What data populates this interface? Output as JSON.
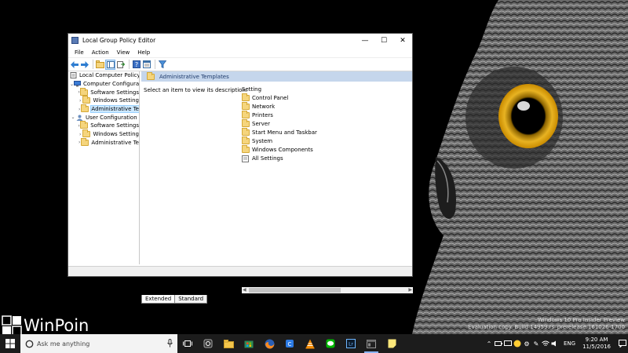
{
  "window": {
    "title": "Local Group Policy Editor",
    "controls": {
      "minimize": "—",
      "maximize": "☐",
      "close": "✕"
    }
  },
  "menu": [
    "File",
    "Action",
    "View",
    "Help"
  ],
  "tree": {
    "root": "Local Computer Policy",
    "computer_config": "Computer Configura",
    "computer_children": [
      "Software Settings",
      "Windows Setting",
      "Administrative Te"
    ],
    "user_config": "User Configuration",
    "user_children": [
      "Software Settings",
      "Windows Setting",
      "Administrative Te"
    ]
  },
  "content": {
    "header": "Administrative Templates",
    "description": "Select an item to view its description.",
    "column_header": "Setting",
    "items": [
      "Control Panel",
      "Network",
      "Printers",
      "Server",
      "Start Menu and Taskbar",
      "System",
      "Windows Components",
      "All Settings"
    ]
  },
  "tabs": [
    "Extended",
    "Standard"
  ],
  "desktop": {
    "brand": "WinPoin",
    "watermark": [
      "Windows 10 Pro Insider Preview",
      "Evaluation copy. Build 14959.rs_prerelease.161026-1700"
    ]
  },
  "taskbar": {
    "search_placeholder": "Ask me anything",
    "language": "ENG",
    "time": "9:20 AM",
    "date": "11/5/2016"
  },
  "colors": {
    "header_bar": "#c5d6ec",
    "folder": "#f5d57d",
    "taskbar": "#1c1c1c",
    "search_bg": "#f3f3f3",
    "selection": "#cce8ff"
  }
}
